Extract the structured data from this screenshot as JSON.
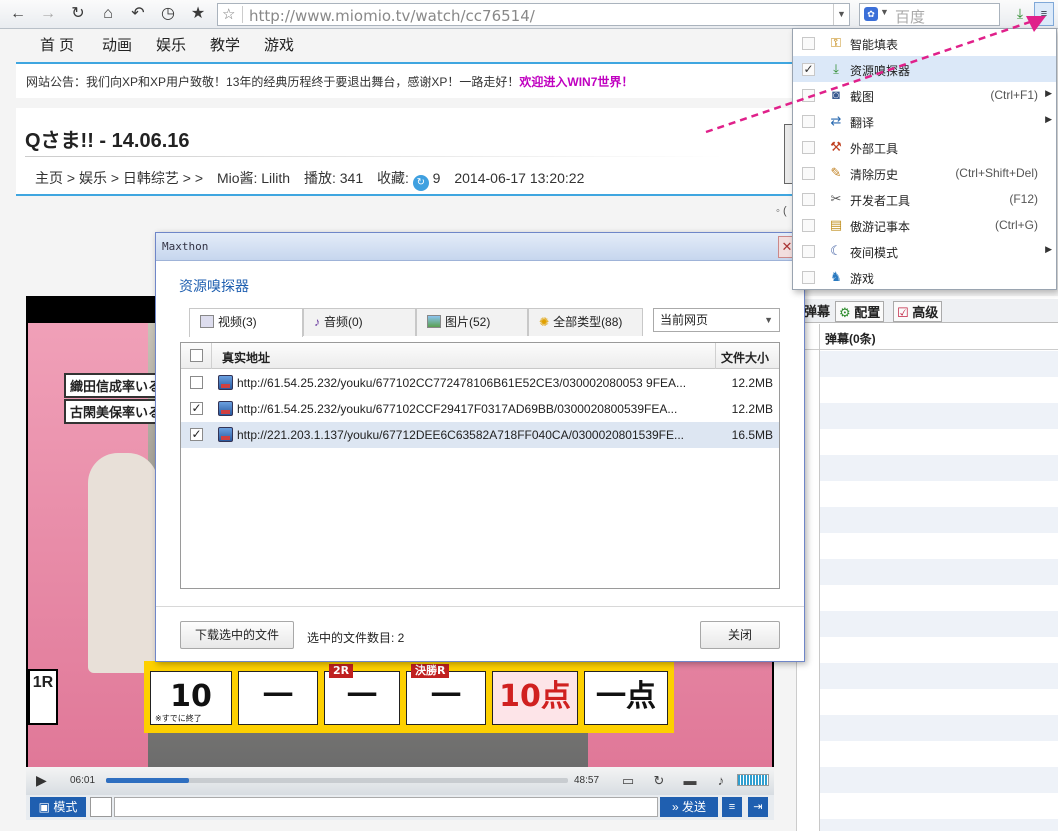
{
  "browser": {
    "url": "http://www.miomio.tv/watch/cc76514/",
    "search_placeholder": "百度",
    "search_engine_icon": "paw-icon"
  },
  "site_nav": [
    "首 页",
    "动画",
    "娱乐",
    "教学",
    "游戏"
  ],
  "notice": {
    "text": "网站公告：我们向XP和XP用户致敬！13年的经典历程终于要退出舞台，感谢XP！一路走好！",
    "link": "欢迎进入WIN7世界！"
  },
  "video": {
    "title": "Qさま!! - 14.06.16",
    "breadcrumb": "主页 > 娱乐 > 日韩综艺 > >",
    "uploader": "Mio酱: Lilith",
    "plays": "播放: 341",
    "favorites_label": "收藏:",
    "favorites": "9",
    "date": "2014-06-17 13:20:22",
    "extra_mark": "◦ (",
    "overlay_names": [
      "織田信成率いる",
      "古閑美保率いる"
    ],
    "scoreboard": {
      "round_label": "1R",
      "cells": [
        {
          "tag": "",
          "value": "10",
          "note": "※すでに終了"
        },
        {
          "tag": "",
          "value": "一",
          "note": ""
        },
        {
          "tag": "2R",
          "value": "一",
          "note": ""
        },
        {
          "tag": "決勝R",
          "value": "一",
          "note": ""
        },
        {
          "tag": "",
          "value": "10点",
          "note": ""
        },
        {
          "tag": "",
          "value": "一点",
          "note": ""
        }
      ]
    },
    "time_current": "06:01",
    "time_total": "48:57",
    "progress": 0.18,
    "mode_label": "模式",
    "send_label": "发送"
  },
  "right_panel": {
    "tabs": [
      "弹幕",
      "配置",
      "高级"
    ],
    "list_header": "弹幕(0条)"
  },
  "sniffer": {
    "window_title": "Maxthon",
    "heading": "资源嗅探器",
    "tabs": [
      "视频(3)",
      "音频(0)",
      "图片(52)",
      "全部类型(88)"
    ],
    "scope": "当前网页",
    "columns": {
      "address": "真实地址",
      "size": "文件大小"
    },
    "rows": [
      {
        "checked": false,
        "url": "http://61.54.25.232/youku/677102CC772478106B61E52CE3/030002080053 9FEA...",
        "size": "12.2MB"
      },
      {
        "checked": true,
        "url": "http://61.54.25.232/youku/677102CCF29417F0317AD69BB/0300020800539FEA...",
        "size": "12.2MB"
      },
      {
        "checked": true,
        "url": "http://221.203.1.137/youku/67712DEE6C63582A718FF040CA/0300020801539FE...",
        "size": "16.5MB"
      }
    ],
    "download_button": "下载选中的文件",
    "selected_count": "选中的文件数目: 2",
    "close_button": "关闭"
  },
  "menu": {
    "items": [
      {
        "label": "智能填表",
        "shortcut": "",
        "checked": false,
        "submenu": false,
        "icon": "key-icon"
      },
      {
        "label": "资源嗅探器",
        "shortcut": "",
        "checked": true,
        "submenu": false,
        "icon": "sniffer-icon"
      },
      {
        "label": "截图",
        "shortcut": "(Ctrl+F1)",
        "checked": false,
        "submenu": true,
        "icon": "camera-icon"
      },
      {
        "label": "翻译",
        "shortcut": "",
        "checked": false,
        "submenu": true,
        "icon": "translate-icon"
      },
      {
        "label": "外部工具",
        "shortcut": "",
        "checked": false,
        "submenu": false,
        "icon": "tools-icon"
      },
      {
        "label": "清除历史",
        "shortcut": "(Ctrl+Shift+Del)",
        "checked": false,
        "submenu": false,
        "icon": "broom-icon"
      },
      {
        "label": "开发者工具",
        "shortcut": "(F12)",
        "checked": false,
        "submenu": false,
        "icon": "wrench-icon"
      },
      {
        "label": "傲游记事本",
        "shortcut": "(Ctrl+G)",
        "checked": false,
        "submenu": false,
        "icon": "notepad-icon"
      },
      {
        "label": "夜间模式",
        "shortcut": "",
        "checked": false,
        "submenu": true,
        "icon": "moon-icon"
      },
      {
        "label": "游戏",
        "shortcut": "",
        "checked": false,
        "submenu": false,
        "icon": "game-icon"
      }
    ]
  },
  "colors": {
    "accent_blue": "#1f5fb0",
    "notice_link": "#c000c0",
    "annotation_arrow": "#e0208a",
    "menu_highlight": "#dbe8f8"
  }
}
